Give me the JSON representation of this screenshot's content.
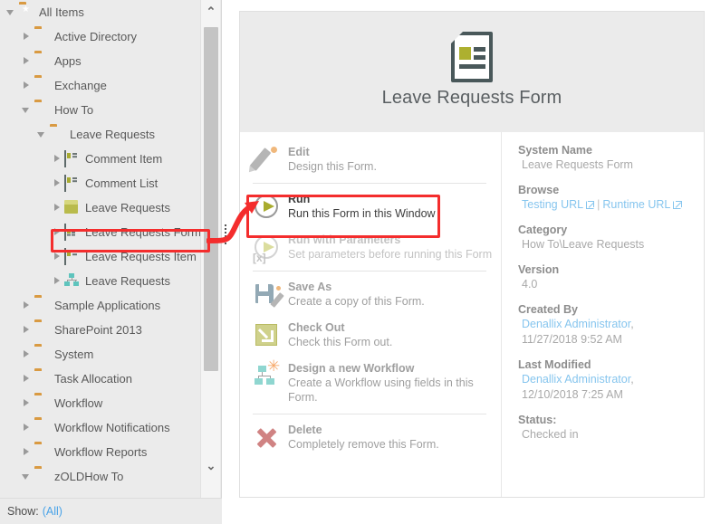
{
  "tree": {
    "nodes": [
      {
        "label": "All Items",
        "indent": 0,
        "twisty": "expanded",
        "icon": "folder-star-icon"
      },
      {
        "label": "Active Directory",
        "indent": 1,
        "twisty": "collapsed",
        "icon": "folder-icon"
      },
      {
        "label": "Apps",
        "indent": 1,
        "twisty": "collapsed",
        "icon": "folder-icon"
      },
      {
        "label": "Exchange",
        "indent": 1,
        "twisty": "collapsed",
        "icon": "folder-icon"
      },
      {
        "label": "How To",
        "indent": 1,
        "twisty": "expanded",
        "icon": "folder-icon"
      },
      {
        "label": "Leave Requests",
        "indent": 2,
        "twisty": "expanded",
        "icon": "folder-icon"
      },
      {
        "label": "Comment Item",
        "indent": 3,
        "twisty": "collapsed",
        "icon": "view-icon"
      },
      {
        "label": "Comment List",
        "indent": 3,
        "twisty": "collapsed",
        "icon": "view-icon"
      },
      {
        "label": "Leave Requests",
        "indent": 3,
        "twisty": "collapsed",
        "icon": "smartobject-icon"
      },
      {
        "label": "Leave Requests Form",
        "indent": 3,
        "twisty": "collapsed",
        "icon": "form-icon",
        "selected": true
      },
      {
        "label": "Leave Requests Item",
        "indent": 3,
        "twisty": "collapsed",
        "icon": "view-icon"
      },
      {
        "label": "Leave Requests",
        "indent": 3,
        "twisty": "collapsed",
        "icon": "workflow-icon"
      },
      {
        "label": "Sample Applications",
        "indent": 1,
        "twisty": "collapsed",
        "icon": "folder-icon"
      },
      {
        "label": "SharePoint 2013",
        "indent": 1,
        "twisty": "collapsed",
        "icon": "folder-icon"
      },
      {
        "label": "System",
        "indent": 1,
        "twisty": "collapsed",
        "icon": "folder-icon"
      },
      {
        "label": "Task Allocation",
        "indent": 1,
        "twisty": "collapsed",
        "icon": "folder-icon"
      },
      {
        "label": "Workflow",
        "indent": 1,
        "twisty": "collapsed",
        "icon": "folder-icon"
      },
      {
        "label": "Workflow Notifications",
        "indent": 1,
        "twisty": "collapsed",
        "icon": "folder-icon"
      },
      {
        "label": "Workflow Reports",
        "indent": 1,
        "twisty": "collapsed",
        "icon": "folder-icon"
      },
      {
        "label": "zOLDHow To",
        "indent": 1,
        "twisty": "expanded",
        "icon": "folder-icon"
      }
    ],
    "footer": {
      "show_label": "Show:",
      "show_value": "(All)"
    },
    "scrollbar": {
      "up_glyph": "⌃",
      "down_glyph": "⌄"
    }
  },
  "detail": {
    "title": "Leave Requests Form",
    "icon": "form-document-icon",
    "actions": [
      {
        "title": "Edit",
        "sub": "Design this Form.",
        "icon": "pencil-icon",
        "state": "normal"
      },
      {
        "title": "Run",
        "sub": "Run this Form in this Window",
        "icon": "play-icon",
        "state": "active"
      },
      {
        "title": "Run with Parameters",
        "sub": "Set parameters before running this Form",
        "icon": "play-params-icon",
        "state": "dim"
      },
      {
        "title": "Save As",
        "sub": "Create a copy of this Form.",
        "icon": "save-as-icon",
        "state": "normal"
      },
      {
        "title": "Check Out",
        "sub": "Check this Form out.",
        "icon": "check-out-icon",
        "state": "normal"
      },
      {
        "title": "Design a new Workflow",
        "sub": "Create a Workflow using fields in this Form.",
        "icon": "workflow-design-icon",
        "state": "normal"
      },
      {
        "title": "Delete",
        "sub": "Completely remove this Form.",
        "icon": "delete-icon",
        "state": "normal"
      }
    ],
    "meta": {
      "system_name_label": "System Name",
      "system_name_value": "Leave Requests Form",
      "browse_label": "Browse",
      "browse_testing": "Testing URL",
      "browse_divider": "|",
      "browse_runtime": "Runtime URL",
      "category_label": "Category",
      "category_value": "How To\\Leave Requests",
      "version_label": "Version",
      "version_value": "4.0",
      "created_by_label": "Created By",
      "created_by_user": "Denallix Administrator",
      "created_by_comma": ",",
      "created_by_date": "11/27/2018 9:52 AM",
      "last_modified_label": "Last Modified",
      "last_modified_user": "Denallix Administrator",
      "last_modified_comma": ",",
      "last_modified_date": "12/10/2018 7:25 AM",
      "status_label": "Status:",
      "status_value": "Checked in"
    }
  },
  "annotations": {
    "highlight_color": "#f42d2d",
    "arrow_name": "red-curved-arrow"
  }
}
